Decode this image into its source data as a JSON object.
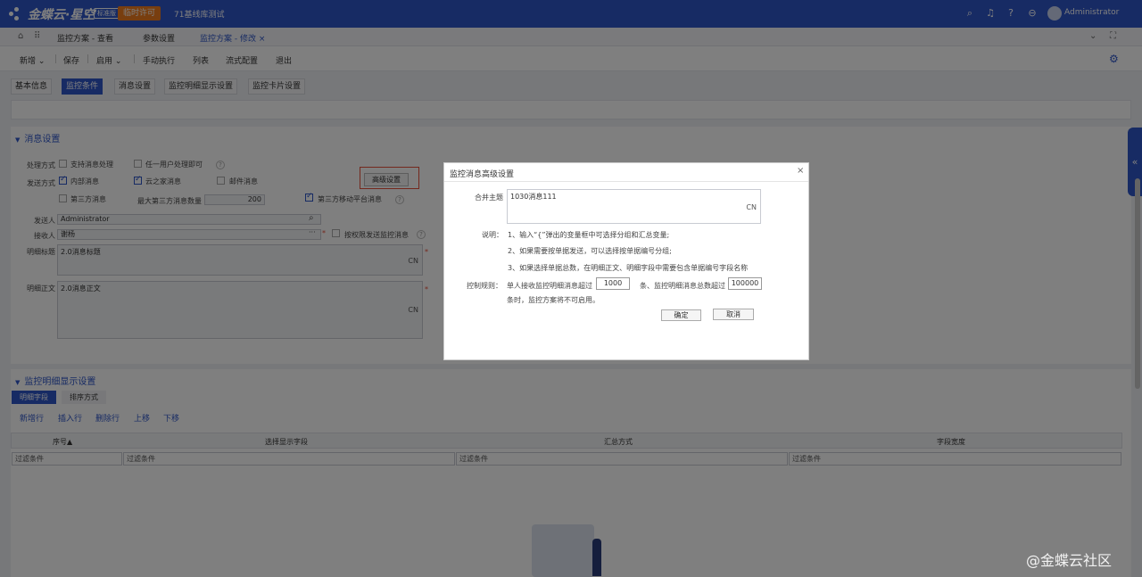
{
  "topbar": {
    "logo": "金蝶云·星空",
    "edition": "标准版",
    "license": "临时许可",
    "tenant": "71基线库测试",
    "user": "Administrator",
    "icons": [
      "search-icon",
      "bell-icon",
      "help-icon",
      "minus-circle-icon",
      "avatar"
    ]
  },
  "nav": {
    "tabs": [
      {
        "label": "监控方案 - 查看"
      },
      {
        "label": "参数设置"
      },
      {
        "label": "监控方案 - 修改",
        "active": true
      }
    ]
  },
  "toolbar": {
    "items": [
      "新增",
      "保存",
      "启用",
      "手动执行",
      "列表",
      "流式配置",
      "退出"
    ]
  },
  "page_tabs": [
    "基本信息",
    "监控条件",
    "消息设置",
    "监控明细显示设置",
    "监控卡片设置"
  ],
  "message_section": {
    "title": "消息设置",
    "process_label": "处理方式",
    "process_opts": [
      "支持消息处理",
      "任一用户处理即可"
    ],
    "send_label": "发送方式",
    "send_opts": [
      "内部消息",
      "云之家消息",
      "邮件消息"
    ],
    "third_party": "第三方消息",
    "max_third_label": "最大第三方消息数量",
    "max_third_value": "200",
    "third_mobile": "第三方移动平台消息",
    "advanced_btn": "高级设置",
    "sender_label": "发送人",
    "sender_value": "Administrator",
    "receiver_label": "接收人",
    "receiver_value": "谢杨",
    "perm_send": "按权限发送监控消息",
    "detail_title_label": "明细标题",
    "detail_title_value": "2.0消息标题",
    "detail_body_label": "明细正文",
    "detail_body_value": "2.0消息正文",
    "cn": "CN"
  },
  "detail_section": {
    "title": "监控明细显示设置",
    "tabs": [
      "明细字段",
      "排序方式"
    ],
    "actions": [
      "新增行",
      "插入行",
      "删除行",
      "上移",
      "下移"
    ],
    "columns": [
      "序号▲",
      "选择显示字段",
      "汇总方式",
      "字段宽度"
    ],
    "filter": "过滤条件"
  },
  "dialog": {
    "title": "监控消息高级设置",
    "close": "×",
    "merge_label": "合并主题",
    "merge_value": "1030消息111",
    "cn": "CN",
    "note_label": "说明：",
    "notes": [
      "1、输入“{”弹出的变量框中可选择分组和汇总变量;",
      "2、如果需要按单据发送，可以选择按单据编号分组;",
      "3、如果选择单据总数，在明细正文、明细字段中需要包含单据编号字段名称"
    ],
    "rule_label": "控制规则：",
    "rule_part1": "单人接收监控明细消息超过",
    "rule_value1": "1000",
    "rule_part2": "条、监控明细消息总数超过",
    "rule_value2": "100000",
    "rule_part3": "条时，监控方案将不可启用。",
    "ok": "确定",
    "cancel": "取消"
  },
  "brand_watermark": "@金蝶云社区",
  "colors": {
    "primary": "#2f56c8",
    "license": "#f07c1e",
    "highlight": "#e8503a"
  }
}
